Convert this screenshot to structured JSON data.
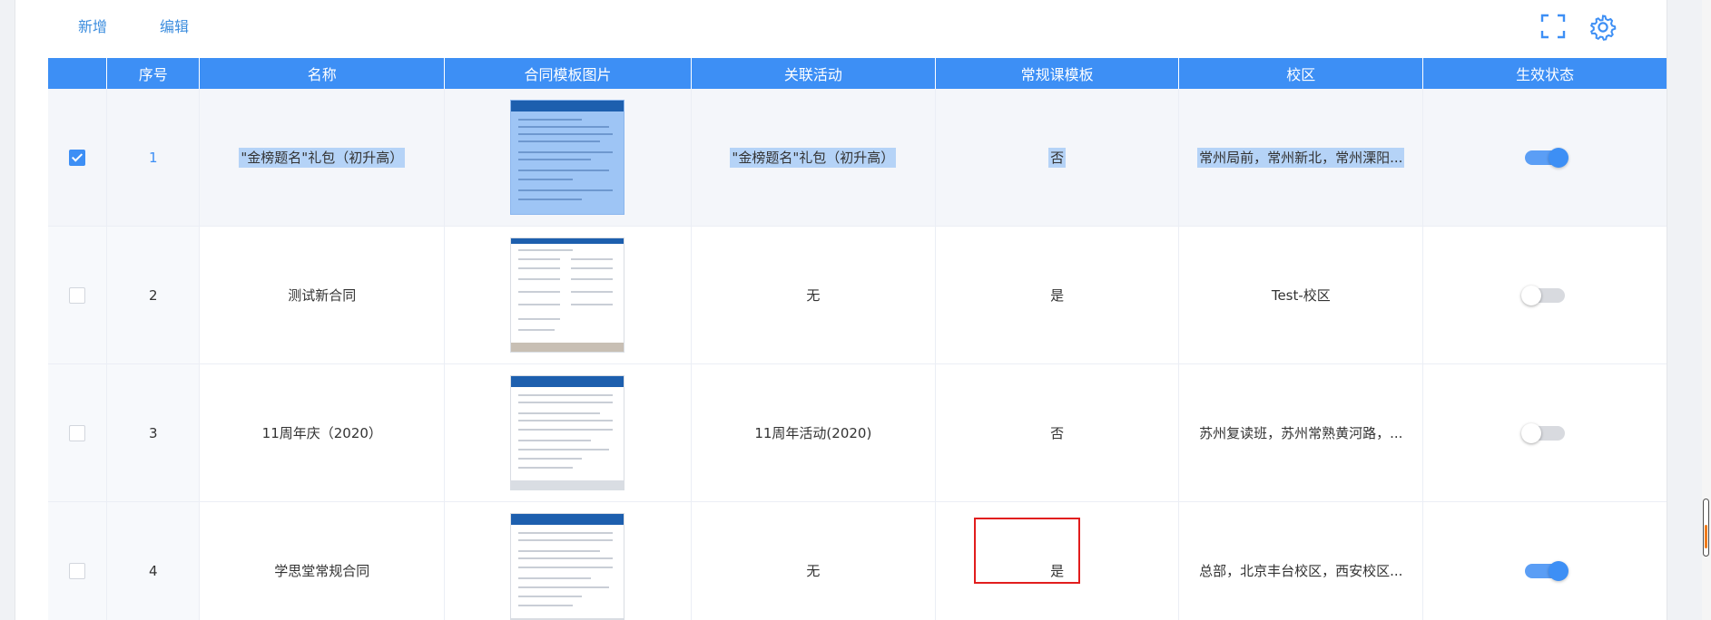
{
  "toolbar": {
    "add_label": "新增",
    "edit_label": "编辑",
    "fullscreen_icon": "fullscreen-icon",
    "settings_icon": "gear-icon"
  },
  "table": {
    "columns": [
      "",
      "序号",
      "名称",
      "合同模板图片",
      "关联活动",
      "常规课模板",
      "校区",
      "生效状态"
    ],
    "rows": [
      {
        "checked": true,
        "index": "1",
        "name": "\"金榜题名\"礼包（初升高）",
        "activity": "\"金榜题名\"礼包（初升高）",
        "regular": "否",
        "campus": "常州局前，常州新北，常州溧阳...",
        "active": true
      },
      {
        "checked": false,
        "index": "2",
        "name": "测试新合同",
        "activity": "无",
        "regular": "是",
        "campus": "Test-校区",
        "active": false
      },
      {
        "checked": false,
        "index": "3",
        "name": "11周年庆（2020）",
        "activity": "11周年活动(2020)",
        "regular": "否",
        "campus": "苏州复读班，苏州常熟黄河路，...",
        "active": false
      },
      {
        "checked": false,
        "index": "4",
        "name": "学思堂常规合同",
        "activity": "无",
        "regular": "是",
        "campus": "总部，北京丰台校区，西安校区...",
        "active": true
      }
    ]
  },
  "colors": {
    "header_bg": "#3d8ff5",
    "accent": "#3d8ff5",
    "highlight_box": "#e11d1d"
  }
}
